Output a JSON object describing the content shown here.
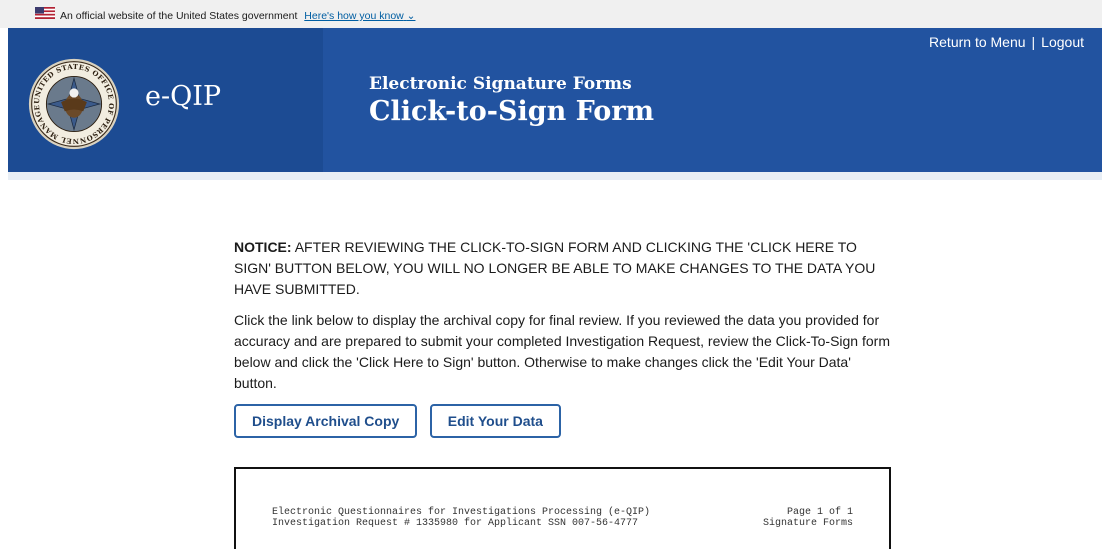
{
  "gov_banner": {
    "text": "An official website of the United States government",
    "how_link": "Here's how you know"
  },
  "header": {
    "app_name": "e-QIP",
    "form_type": "Electronic Signature Forms",
    "form_title": "Click-to-Sign Form",
    "links": {
      "return": "Return to Menu",
      "sep": "|",
      "logout": "Logout"
    },
    "seal_text": "UNITED STATES OFFICE OF PERSONNEL MANAGEMENT"
  },
  "notice": {
    "label": "NOTICE:",
    "text": "AFTER REVIEWING THE CLICK-TO-SIGN FORM AND CLICKING THE 'CLICK HERE TO SIGN' BUTTON BELOW, YOU WILL NO LONGER BE ABLE TO MAKE CHANGES TO THE DATA YOU HAVE SUBMITTED."
  },
  "instructions": "Click the link below to display the archival copy for final review. If you reviewed the data you provided for accuracy and are prepared to submit your completed Investigation Request, review the Click-To-Sign form below and click the 'Click Here to Sign' button. Otherwise to make changes click the 'Edit Your Data' button.",
  "buttons": {
    "archival": "Display Archival Copy",
    "edit": "Edit Your Data"
  },
  "document": {
    "line1_left": "Electronic Questionnaires for Investigations Processing (e-QIP)",
    "line1_right": "Page 1 of 1",
    "line2_left": "Investigation Request # 1335980 for Applicant SSN 007-56-4777",
    "line2_right": "Signature Forms"
  }
}
